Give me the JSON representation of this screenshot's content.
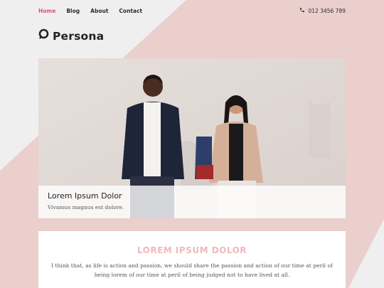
{
  "nav": {
    "items": [
      {
        "label": "Home",
        "active": true
      },
      {
        "label": "Blog",
        "active": false
      },
      {
        "label": "About",
        "active": false
      },
      {
        "label": "Contact",
        "active": false
      }
    ]
  },
  "header": {
    "phone": "012 3456 789",
    "phone_icon": "phone-icon",
    "logo_text": "Persona",
    "logo_icon": "speech-bubble-icon"
  },
  "hero": {
    "title": "Lorem Ipsum Dolor",
    "subtitle": "Vivamus magnus est dolore."
  },
  "feature": {
    "title": "LOREM IPSUM DOLOR",
    "text": "I think that, as life is action and passion, we should share the passion and action of our time at peril of being lorem of our time at peril of being judged not to have lived at all."
  },
  "colors": {
    "accent": "#e0536a",
    "pink_bg": "#ebcfcd",
    "light_bg": "#efefef",
    "heading_pink": "#f0b9bc"
  }
}
